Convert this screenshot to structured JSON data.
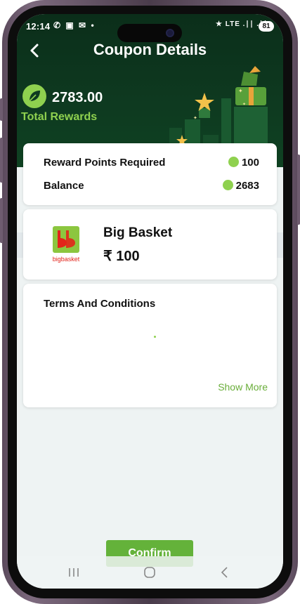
{
  "status_bar": {
    "time": "12:14",
    "left_icons": "✆ ▣ ✉ •",
    "right_icons": "★ LTE .∣∣ .∣∣",
    "battery": "81"
  },
  "header": {
    "back_glyph": "‹",
    "title": "Coupon Details",
    "total_rewards_value": "2783.00",
    "total_rewards_label": "Total Rewards"
  },
  "points_card": {
    "required_label": "Reward Points Required",
    "required_value": "100",
    "balance_label": "Balance",
    "balance_value": "2683"
  },
  "brand_card": {
    "brand_name": "Big Basket",
    "price": "₹ 100",
    "logo_text": "bigbasket"
  },
  "terms_card": {
    "title": "Terms And Conditions",
    "show_more": "Show More"
  },
  "confirm_label": "Confirm",
  "nav": {
    "recents": "|||",
    "home": "○",
    "back": "‹"
  },
  "colors": {
    "header_bg": "#0e3a20",
    "accent_green": "#8fd14f",
    "button_green": "#64b23a",
    "screen_bg": "#eef3f3"
  }
}
